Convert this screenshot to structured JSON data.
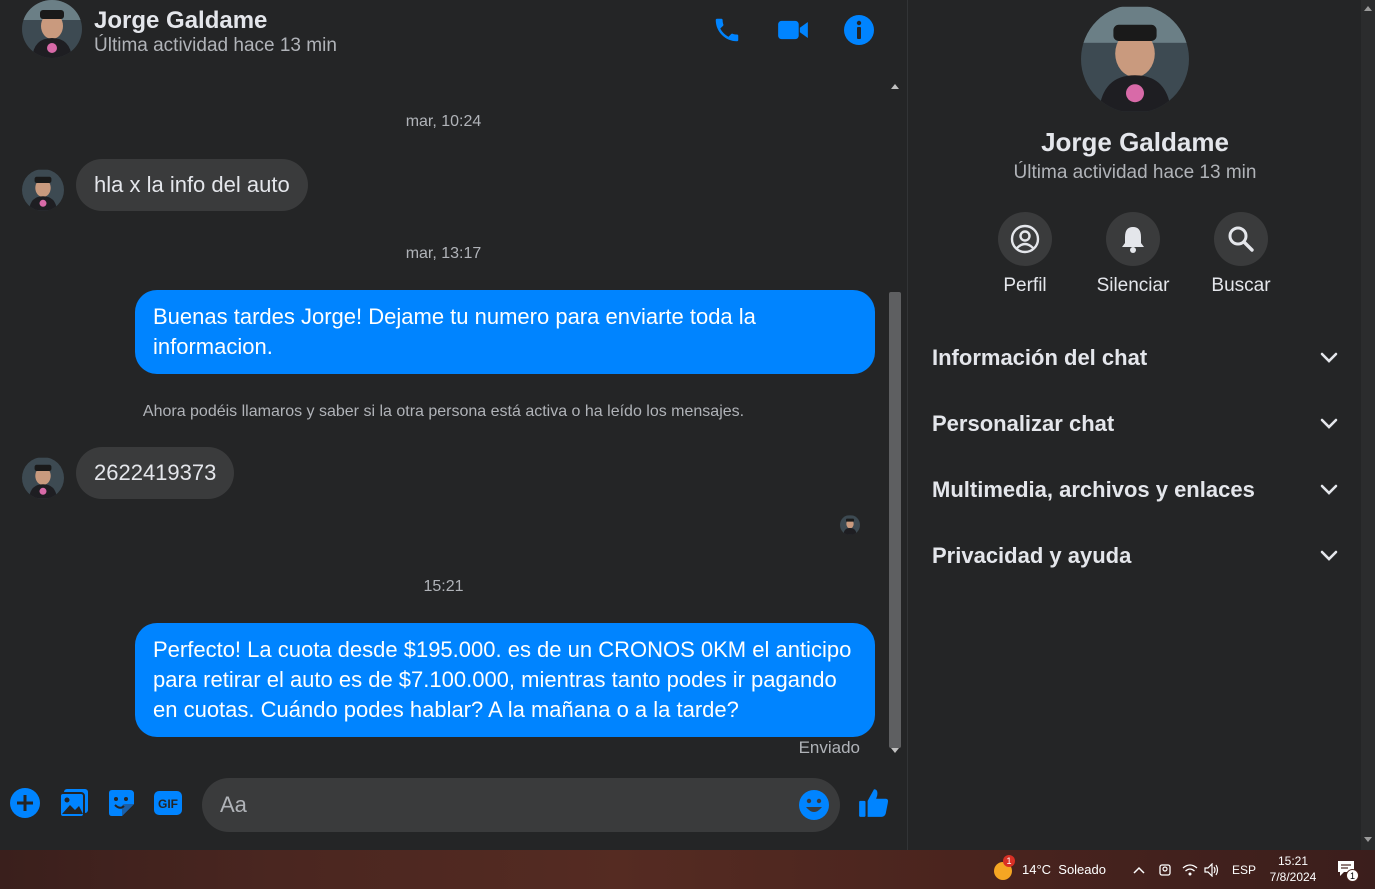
{
  "header": {
    "name": "Jorge Galdame",
    "status": "Última actividad hace 13 min"
  },
  "messages": {
    "ts1": "mar, 10:24",
    "msg1": "hla x la info del auto",
    "ts2": "mar, 13:17",
    "msg2": "Buenas tardes Jorge! Dejame tu numero para enviarte toda la informacion.",
    "system": "Ahora podéis llamaros y saber si la otra persona está activa o ha leído los mensajes.",
    "msg3": "2622419373",
    "ts3": "15:21",
    "msg4": "Perfecto! La cuota desde $195.000. es de un CRONOS 0KM el anticipo para retirar el auto es de $7.100.000, mientras tanto podes ir pagando en cuotas. Cuándo podes hablar? A la mañana o a la tarde?",
    "sent_status": "Enviado"
  },
  "composer": {
    "placeholder": "Aa",
    "icons": [
      "plus-circle-icon",
      "image-icon",
      "sticker-icon",
      "gif-icon",
      "emoji-icon",
      "like-icon"
    ]
  },
  "info_panel": {
    "name": "Jorge Galdame",
    "status": "Última actividad hace 13 min",
    "actions": [
      {
        "label": "Perfil",
        "icon": "profile-icon"
      },
      {
        "label": "Silenciar",
        "icon": "bell-icon"
      },
      {
        "label": "Buscar",
        "icon": "search-icon"
      }
    ],
    "sections": [
      {
        "title": "Información del chat"
      },
      {
        "title": "Personalizar chat"
      },
      {
        "title": "Multimedia, archivos y enlaces"
      },
      {
        "title": "Privacidad y ayuda"
      }
    ]
  },
  "taskbar": {
    "weather": "14°C  Soleado",
    "weather_badge": "1",
    "language": "ESP",
    "time": "15:21",
    "date": "7/8/2024",
    "notification_count": "1"
  },
  "colors": {
    "accent": "#0084ff",
    "background": "#242526",
    "bubble_in": "#3a3b3c"
  }
}
